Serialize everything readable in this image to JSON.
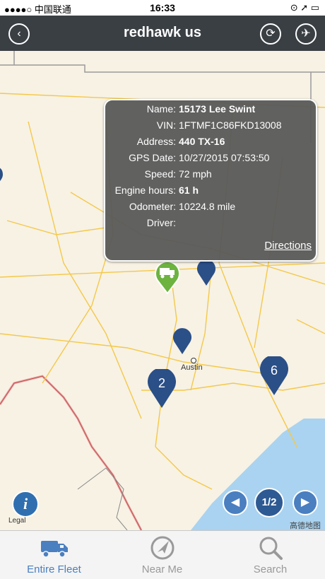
{
  "status_bar": {
    "carrier": "●●●●○ 中国联通",
    "time": "16:33",
    "right": "⊙ ➚ ▭"
  },
  "header": {
    "title": "redhawk us",
    "back_icon": "chevron-left-icon",
    "refresh_icon": "refresh-icon",
    "satellite_icon": "satellite-icon"
  },
  "popup": {
    "fields": [
      {
        "label": "Name:",
        "value": "15173 Lee Swint",
        "bold": true
      },
      {
        "label": "VIN:",
        "value": "1FTMF1C86FKD13008",
        "bold": false
      },
      {
        "label": "Address:",
        "value": "440 TX-16",
        "bold": true
      },
      {
        "label": "GPS Date:",
        "value": "10/27/2015 07:53:50",
        "bold": false
      },
      {
        "label": "Speed:",
        "value": "72 mph",
        "bold": false
      },
      {
        "label": "Engine hours:",
        "value": "61 h",
        "bold": true
      },
      {
        "label": "Odometer:",
        "value": "10224.8 mile",
        "bold": false
      },
      {
        "label": "Driver:",
        "value": "",
        "bold": false
      }
    ],
    "directions_label": "Directions"
  },
  "map": {
    "city_label": "Austin",
    "cluster_a": "2",
    "cluster_b": "6",
    "legal": "Legal",
    "attribution": "高德地图"
  },
  "pagination": {
    "prev": "◀",
    "page": "1/2",
    "next": "▶"
  },
  "tabs": [
    {
      "label": "Entire Fleet",
      "icon": "truck-icon",
      "active": true
    },
    {
      "label": "Near Me",
      "icon": "compass-icon",
      "active": false
    },
    {
      "label": "Search",
      "icon": "magnifier-icon",
      "active": false
    }
  ],
  "colors": {
    "navbar": "#3a3f44",
    "pin": "#2b4f87",
    "active_pin": "#6cb33f",
    "water": "#a9d3f0",
    "accent": "#4a7fc0"
  }
}
